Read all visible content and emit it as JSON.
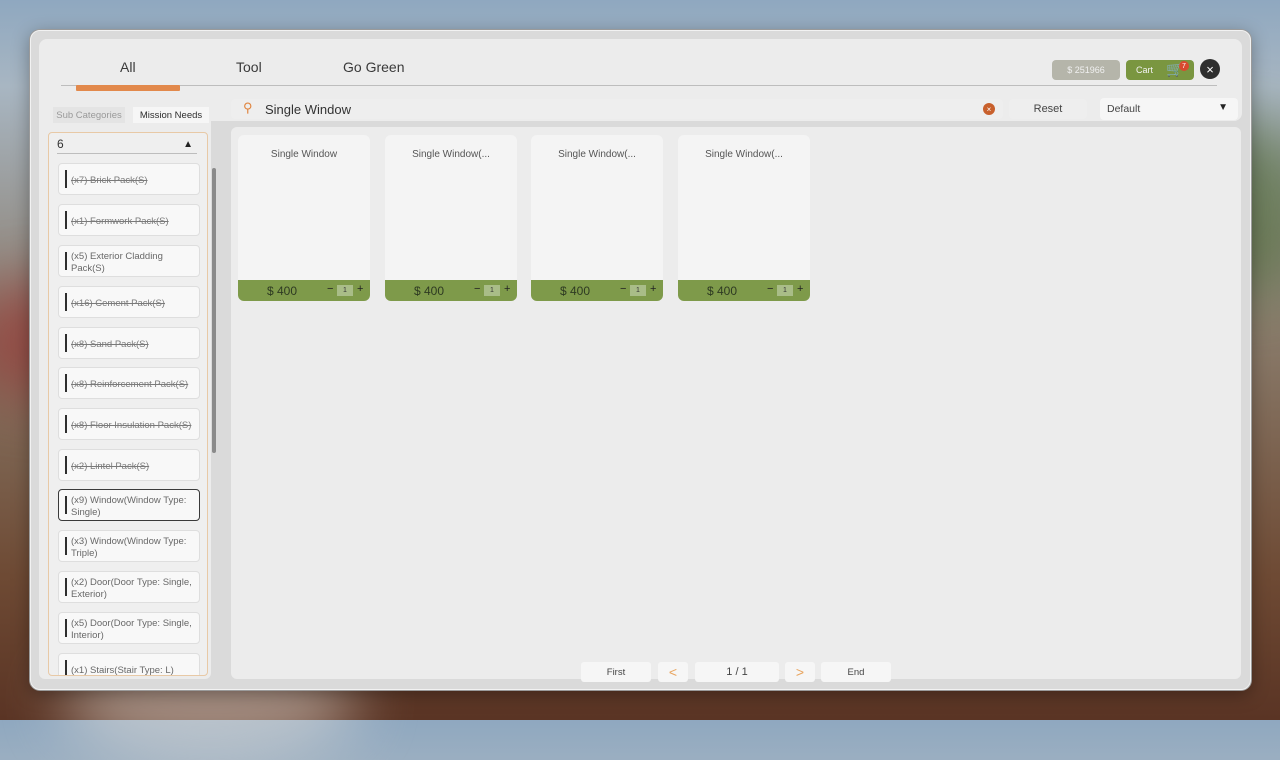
{
  "tabs": [
    {
      "label": "All",
      "active": true
    },
    {
      "label": "Tool",
      "active": false
    },
    {
      "label": "Go Green",
      "active": false
    }
  ],
  "header": {
    "money": "$ 251966",
    "cart_label": "Cart",
    "cart_count": "7",
    "close_icon": "×",
    "cart_icon": "🛒"
  },
  "left_panel": {
    "subtabs": [
      "Sub Categories",
      "Mission Needs"
    ],
    "active_subtab": "Mission Needs",
    "dropdown_value": "6",
    "dropdown_caret": "▲",
    "items": [
      {
        "label": "(x7) Brick Pack(S)",
        "done": true
      },
      {
        "label": "(x1) Formwork Pack(S)",
        "done": true
      },
      {
        "label": "(x5) Exterior Cladding Pack(S)",
        "done": false
      },
      {
        "label": "(x16) Cement Pack(S)",
        "done": true
      },
      {
        "label": "(x8) Sand Pack(S)",
        "done": true
      },
      {
        "label": "(x8) Reinforcement Pack(S)",
        "done": true
      },
      {
        "label": "(x8) Floor Insulation Pack(S)",
        "done": true
      },
      {
        "label": "(x2) Lintel Pack(S)",
        "done": true
      },
      {
        "label": "(x9) Window(Window Type: Single)",
        "done": false,
        "selected": true
      },
      {
        "label": "(x3) Window(Window Type: Triple)",
        "done": false
      },
      {
        "label": "(x2) Door(Door Type: Single, Exterior)",
        "done": false
      },
      {
        "label": "(x5) Door(Door Type: Single, Interior)",
        "done": false
      },
      {
        "label": "(x1) Stairs(Stair Type: L)",
        "done": false
      }
    ]
  },
  "search": {
    "icon": "⚲",
    "value": "Single Window",
    "clear_icon": "×"
  },
  "reset_label": "Reset",
  "sort": {
    "value": "Default",
    "caret": "▼"
  },
  "products": [
    {
      "name": "Single Window",
      "price": "$ 400",
      "qty": "1"
    },
    {
      "name": "Single Window(...",
      "price": "$ 400",
      "qty": "1"
    },
    {
      "name": "Single Window(...",
      "price": "$ 400",
      "qty": "1"
    },
    {
      "name": "Single Window(...",
      "price": "$ 400",
      "qty": "1"
    }
  ],
  "qty_minus": "−",
  "qty_plus": "+",
  "pager": {
    "first": "First",
    "prev": "<",
    "page": "1 / 1",
    "next": ">",
    "end": "End"
  },
  "colors": {
    "accent": "#e2894c",
    "green": "#7e9a4a",
    "panel": "#ececec"
  }
}
